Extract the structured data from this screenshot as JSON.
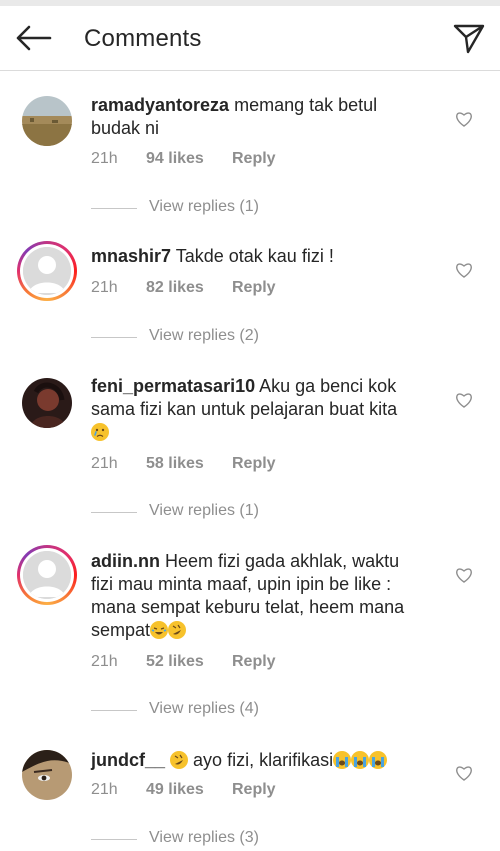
{
  "header": {
    "title": "Comments",
    "back_icon": "arrow-left-icon",
    "direct_icon": "paper-plane-icon"
  },
  "comments": [
    {
      "username": "ramadyantoreza",
      "text": "memang tak betul budak ni",
      "time": "21h",
      "likes": "94 likes",
      "reply_label": "Reply",
      "view_replies": "View replies (1)",
      "avatar": "landscape-photo"
    },
    {
      "username": "mnashir7",
      "text": "Takde otak kau fizi !",
      "time": "21h",
      "likes": "82 likes",
      "reply_label": "Reply",
      "view_replies": "View replies (2)",
      "avatar": "default-avatar-with-story-ring"
    },
    {
      "username": "feni_permatasari10",
      "text": "Aku ga benci kok sama fizi  kan untuk pelajaran buat kita",
      "time": "21h",
      "likes": "58 likes",
      "reply_label": "Reply",
      "view_replies": "View replies (1)",
      "avatar": "dark-portrait"
    },
    {
      "username": "adiin.nn",
      "text": "Heem fizi gada akhlak, waktu fizi mau minta maaf, upin ipin be like : mana sempat keburu telat, heem mana sempat",
      "time": "21h",
      "likes": "52 likes",
      "reply_label": "Reply",
      "view_replies": "View replies (4)",
      "avatar": "default-avatar-with-story-ring"
    },
    {
      "username": "jundcf__",
      "text": "ayo fizi, klarifikasi",
      "time": "21h",
      "likes": "49 likes",
      "reply_label": "Reply",
      "view_replies": "View replies (3)",
      "avatar": "face-photo"
    }
  ],
  "colors": {
    "text": "#262626",
    "secondary": "#8e8e8e",
    "divider": "#dbdbdb",
    "emoji": "#f7c22c"
  }
}
